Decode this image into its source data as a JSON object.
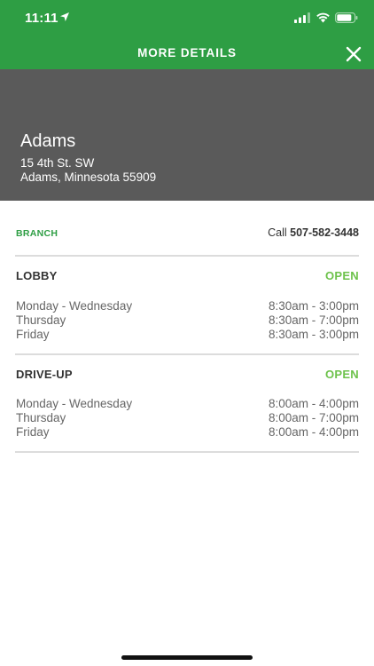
{
  "status_bar": {
    "time": "11:11"
  },
  "nav": {
    "title": "MORE DETAILS"
  },
  "branch": {
    "name": "Adams",
    "address_line1": "15 4th St. SW",
    "address_line2": "Adams, Minnesota 55909",
    "type_label": "BRANCH",
    "call_prefix": "Call",
    "phone": "507-582-3448"
  },
  "sections": [
    {
      "title": "LOBBY",
      "status": "OPEN",
      "rows": [
        {
          "days": "Monday - Wednesday",
          "hours": "8:30am - 3:00pm"
        },
        {
          "days": "Thursday",
          "hours": "8:30am - 7:00pm"
        },
        {
          "days": "Friday",
          "hours": "8:30am - 3:00pm"
        }
      ]
    },
    {
      "title": "DRIVE-UP",
      "status": "OPEN",
      "rows": [
        {
          "days": "Monday - Wednesday",
          "hours": "8:00am - 4:00pm"
        },
        {
          "days": "Thursday",
          "hours": "8:00am - 7:00pm"
        },
        {
          "days": "Friday",
          "hours": "8:00am - 4:00pm"
        }
      ]
    }
  ],
  "colors": {
    "header_green": "#2e9e44",
    "hero_gray": "#5a5a5a",
    "open_green": "#6dc24b",
    "label_green": "#2e9e44"
  },
  "icons": {
    "location": "location-arrow-icon",
    "signal": "cellular-signal-icon",
    "wifi": "wifi-icon",
    "battery": "battery-icon",
    "close": "close-icon"
  }
}
